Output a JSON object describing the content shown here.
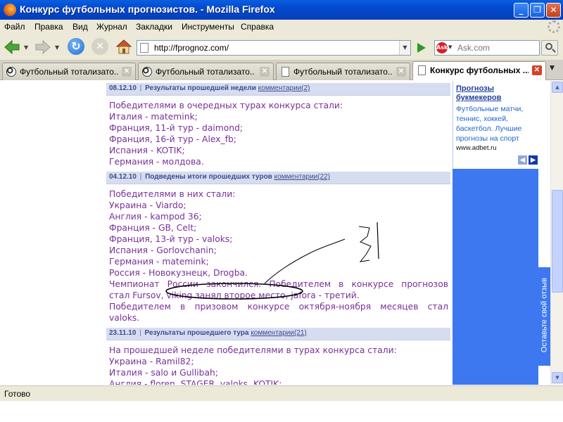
{
  "window": {
    "title": "Конкурс футбольных прогнозистов. - Mozilla Firefox",
    "controls": {
      "minimize": "_",
      "maximize": "❐",
      "close": "✕"
    }
  },
  "menu": [
    "Файл",
    "Правка",
    "Вид",
    "Журнал",
    "Закладки",
    "Инструменты",
    "Справка"
  ],
  "nav": {
    "url": "http://fprognoz.com/",
    "search_engine": "Ask",
    "search_placeholder": "Ask.com"
  },
  "tabs": [
    {
      "title": "Футбольный тотализато...",
      "icon": "soccer-ball-icon",
      "active": false
    },
    {
      "title": "Футбольный тотализато...",
      "icon": "soccer-ball-icon",
      "active": false
    },
    {
      "title": "Футбольный тотализато...",
      "icon": "page-icon",
      "active": false
    },
    {
      "title": "Конкурс футбольных ...",
      "icon": "page-icon",
      "active": true
    }
  ],
  "news": [
    {
      "date": "08.12.10",
      "title": "Результаты прошедшей недели",
      "comments": "комментарии(2)",
      "lines": [
        "Победителями в очередных турах конкурса стали:",
        "Италия - matemink;",
        "Франция, 11-й тур - daimond;",
        "Франция, 16-й тур - Alex_fb;",
        "Испания - KOTIK;",
        "Германия - молдова."
      ]
    },
    {
      "date": "04.12.10",
      "title": "Подведены итоги прошедших туров",
      "comments": "комментарии(22)",
      "lines": [
        "Победителями в них стали:",
        "Украина - Viardo;",
        "Англия - kampod 36;",
        "Франция - GB, Celt;",
        "Франция, 13-й тур - valoks;",
        "Испания - Gorlovchanin;",
        "Германия - matemink;",
        "Россия - Новокузнецк, Drogba.",
        "Чемпионат России закончился. Победителем в конкурсе прогнозов",
        "стал Fursov, viking занял второе место, jafora - третий.",
        "Победителем в призовом конкурсе октября-ноября месяцев стал",
        "valoks."
      ]
    },
    {
      "date": "23.11.10",
      "title": "Результаты прошедшего тура",
      "comments": "комментарии(21)",
      "lines": [
        "На прошедшей неделе победителями в турах конкурса стали:",
        "Украина - Ramil82;",
        "Италия - salo и Gullibah;",
        "Англия - floren, STAGER, valoks, KOTIK;"
      ]
    }
  ],
  "ad": {
    "title_line1": "Прогнозы",
    "title_line2": "букмекеров",
    "body": [
      "Футбольные матчи,",
      "теннис, хоккей,",
      "баскетбол. Лучшие",
      "прогнозы на спорт"
    ],
    "url": "www.adbet.ru"
  },
  "feedback_label": "Оставьте свой отзыв",
  "status": "Готово",
  "colors": {
    "news_text": "#7a2f9a",
    "news_header_bg": "#d7ddf0",
    "sidebar_blue": "#3d78f0",
    "titlebar_blue": "#0349cf"
  }
}
